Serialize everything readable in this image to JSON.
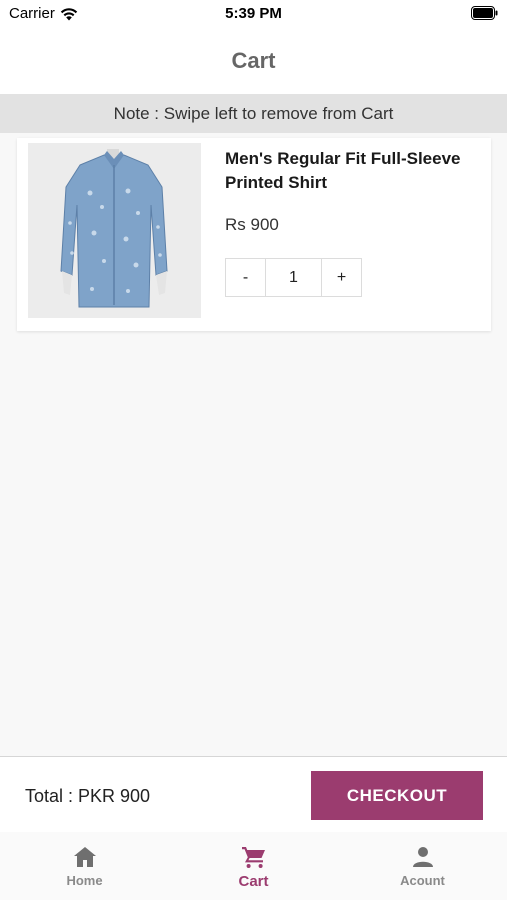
{
  "status_bar": {
    "carrier": "Carrier",
    "time": "5:39 PM"
  },
  "header": {
    "title": "Cart"
  },
  "note": "Note : Swipe left to remove from Cart",
  "cart": {
    "items": [
      {
        "name": "Men's Regular Fit Full-Sleeve Printed Shirt",
        "price": "Rs 900",
        "quantity": "1",
        "decrement_label": "-",
        "increment_label": "+"
      }
    ]
  },
  "footer": {
    "total_text": "Total : PKR 900",
    "checkout_label": "CHECKOUT"
  },
  "tabs": [
    {
      "label": "Home",
      "icon": "home-icon",
      "active": false
    },
    {
      "label": "Cart",
      "icon": "cart-icon",
      "active": true
    },
    {
      "label": "Acount",
      "icon": "person-icon",
      "active": false
    }
  ],
  "colors": {
    "accent": "#9b3c6f",
    "inactive_tab": "#8a8a8a",
    "header_title": "#666666",
    "note_bg": "#e2e2e2"
  }
}
